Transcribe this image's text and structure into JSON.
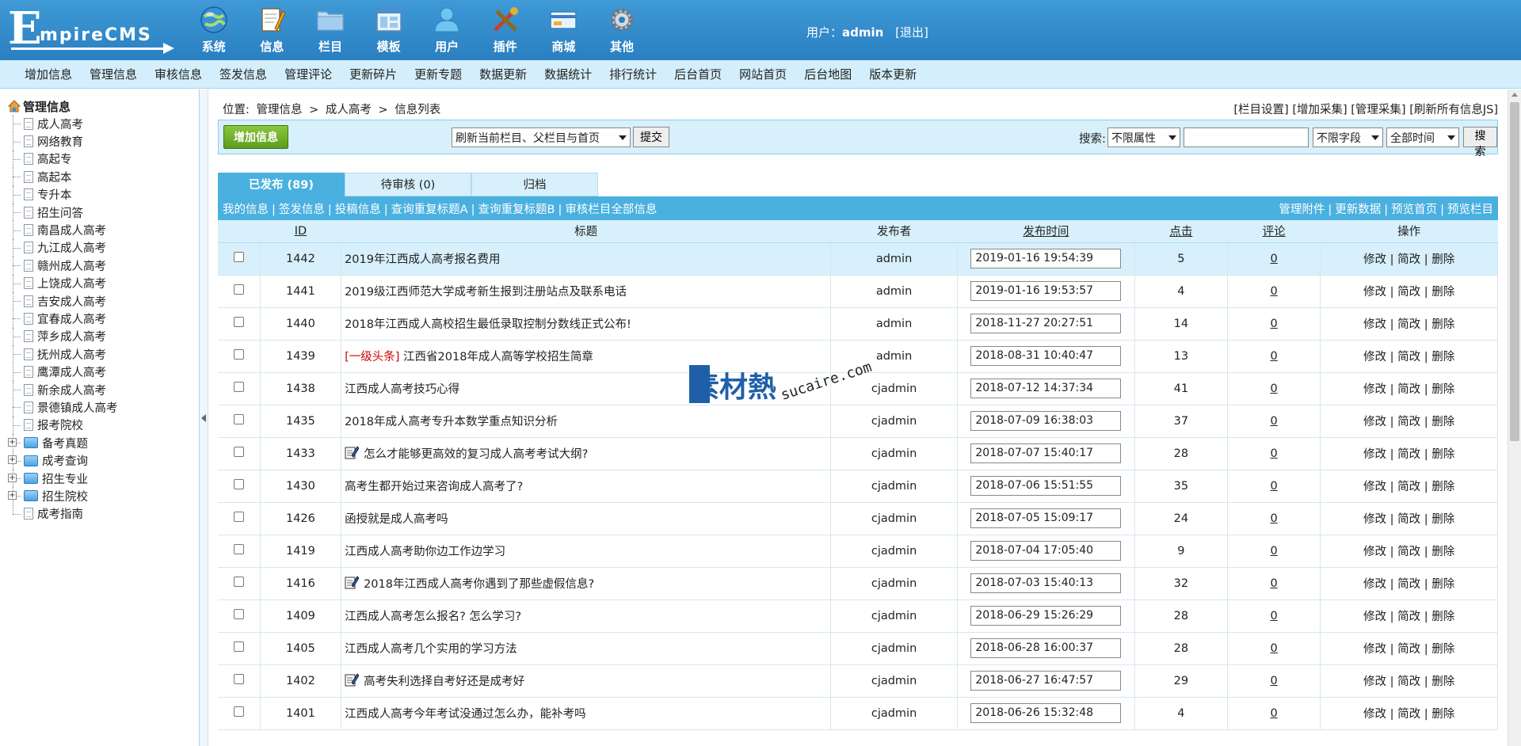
{
  "app": {
    "logo_initial": "E",
    "logo_rest": "mpireCMS"
  },
  "topnav": [
    {
      "label": "系统",
      "icon": "globe-icon"
    },
    {
      "label": "信息",
      "icon": "notepad-icon"
    },
    {
      "label": "栏目",
      "icon": "folder-icon"
    },
    {
      "label": "模板",
      "icon": "window-icon"
    },
    {
      "label": "用户",
      "icon": "user-icon"
    },
    {
      "label": "插件",
      "icon": "tools-icon"
    },
    {
      "label": "商城",
      "icon": "card-icon"
    },
    {
      "label": "其他",
      "icon": "gear-icon"
    }
  ],
  "user": {
    "prefix": "用户：",
    "name": "admin",
    "logout": "[退出]"
  },
  "menubar": [
    "增加信息",
    "管理信息",
    "审核信息",
    "签发信息",
    "管理评论",
    "更新碎片",
    "更新专题",
    "数据更新",
    "数据统计",
    "排行统计",
    "后台首页",
    "网站首页",
    "后台地图",
    "版本更新"
  ],
  "sidebar": {
    "root": "管理信息",
    "items": [
      "成人高考",
      "网络教育",
      "高起专",
      "高起本",
      "专升本",
      "招生问答",
      "南昌成人高考",
      "九江成人高考",
      "赣州成人高考",
      "上饶成人高考",
      "吉安成人高考",
      "宜春成人高考",
      "萍乡成人高考",
      "抚州成人高考",
      "鹰潭成人高考",
      "新余成人高考",
      "景德镇成人高考",
      "报考院校"
    ],
    "folders": [
      "备考真题",
      "成考查询",
      "招生专业",
      "招生院校"
    ],
    "last": "成考指南"
  },
  "breadcrumb": {
    "label": "位置:",
    "parts": [
      "管理信息",
      ">",
      "成人高考",
      ">",
      "信息列表"
    ]
  },
  "toplinks": [
    "[栏目设置]",
    "[增加采集]",
    "[管理采集]",
    "[刷新所有信息JS]"
  ],
  "toolbar": {
    "add_label": "增加信息",
    "refresh_select": "刷新当前栏目、父栏目与首页",
    "submit_label": "提交",
    "search_label": "搜索:",
    "attr_select": "不限属性",
    "search_value": "",
    "field_select": "不限字段",
    "time_select": "全部时间",
    "search_button": "搜索"
  },
  "tabs": [
    "已发布 (89)",
    "待审核 (0)",
    "归档"
  ],
  "actions_left": [
    "我的信息",
    "签发信息",
    "投稿信息",
    "查询重复标题A",
    "查询重复标题B",
    "审核栏目全部信息"
  ],
  "actions_right": [
    "管理附件",
    "更新数据",
    "预览首页",
    "预览栏目"
  ],
  "table": {
    "columns": [
      "ID",
      "标题",
      "发布者",
      "发布时间",
      "点击",
      "评论",
      "操作"
    ],
    "ops": [
      "修改",
      "|",
      "简改",
      "|",
      "删除"
    ],
    "rows": [
      {
        "id": "1442",
        "title": "2019年江西成人高考报名费用",
        "tag": "",
        "publisher": "admin",
        "time": "2019-01-16 19:54:39",
        "clicks": "5",
        "comments": "0",
        "icon": false
      },
      {
        "id": "1441",
        "title": "2019级江西师范大学成考新生报到注册站点及联系电话",
        "tag": "",
        "publisher": "admin",
        "time": "2019-01-16 19:53:57",
        "clicks": "4",
        "comments": "0",
        "icon": false
      },
      {
        "id": "1440",
        "title": "2018年江西成人高校招生最低录取控制分数线正式公布!",
        "tag": "",
        "publisher": "admin",
        "time": "2018-11-27 20:27:51",
        "clicks": "14",
        "comments": "0",
        "icon": false
      },
      {
        "id": "1439",
        "title": "江西省2018年成人高等学校招生简章",
        "tag": "[一级头条]",
        "publisher": "admin",
        "time": "2018-08-31 10:40:47",
        "clicks": "13",
        "comments": "0",
        "icon": false
      },
      {
        "id": "1438",
        "title": "江西成人高考技巧心得",
        "tag": "",
        "publisher": "cjadmin",
        "time": "2018-07-12 14:37:34",
        "clicks": "41",
        "comments": "0",
        "icon": false
      },
      {
        "id": "1435",
        "title": "2018年成人高考专升本数学重点知识分析",
        "tag": "",
        "publisher": "cjadmin",
        "time": "2018-07-09 16:38:03",
        "clicks": "37",
        "comments": "0",
        "icon": false
      },
      {
        "id": "1433",
        "title": "怎么才能够更高效的复习成人高考考试大纲?",
        "tag": "",
        "publisher": "cjadmin",
        "time": "2018-07-07 15:40:17",
        "clicks": "28",
        "comments": "0",
        "icon": true
      },
      {
        "id": "1430",
        "title": "高考生都开始过来咨询成人高考了?",
        "tag": "",
        "publisher": "cjadmin",
        "time": "2018-07-06 15:51:55",
        "clicks": "35",
        "comments": "0",
        "icon": false
      },
      {
        "id": "1426",
        "title": "函授就是成人高考吗",
        "tag": "",
        "publisher": "cjadmin",
        "time": "2018-07-05 15:09:17",
        "clicks": "24",
        "comments": "0",
        "icon": false
      },
      {
        "id": "1419",
        "title": "江西成人高考助你边工作边学习",
        "tag": "",
        "publisher": "cjadmin",
        "time": "2018-07-04 17:05:40",
        "clicks": "9",
        "comments": "0",
        "icon": false
      },
      {
        "id": "1416",
        "title": "2018年江西成人高考你遇到了那些虚假信息?",
        "tag": "",
        "publisher": "cjadmin",
        "time": "2018-07-03 15:40:13",
        "clicks": "32",
        "comments": "0",
        "icon": true
      },
      {
        "id": "1409",
        "title": "江西成人高考怎么报名? 怎么学习?",
        "tag": "",
        "publisher": "cjadmin",
        "time": "2018-06-29 15:26:29",
        "clicks": "28",
        "comments": "0",
        "icon": false
      },
      {
        "id": "1405",
        "title": "江西成人高考几个实用的学习方法",
        "tag": "",
        "publisher": "cjadmin",
        "time": "2018-06-28 16:00:37",
        "clicks": "28",
        "comments": "0",
        "icon": false
      },
      {
        "id": "1402",
        "title": "高考失利选择自考好还是成考好",
        "tag": "",
        "publisher": "cjadmin",
        "time": "2018-06-27 16:47:57",
        "clicks": "29",
        "comments": "0",
        "icon": true
      },
      {
        "id": "1401",
        "title": "江西成人高考今年考试没通过怎么办，能补考吗",
        "tag": "",
        "publisher": "cjadmin",
        "time": "2018-06-26 15:32:48",
        "clicks": "4",
        "comments": "0",
        "icon": false
      }
    ]
  },
  "watermark": {
    "cn": "素材熱",
    "en": "sucaire.com"
  }
}
